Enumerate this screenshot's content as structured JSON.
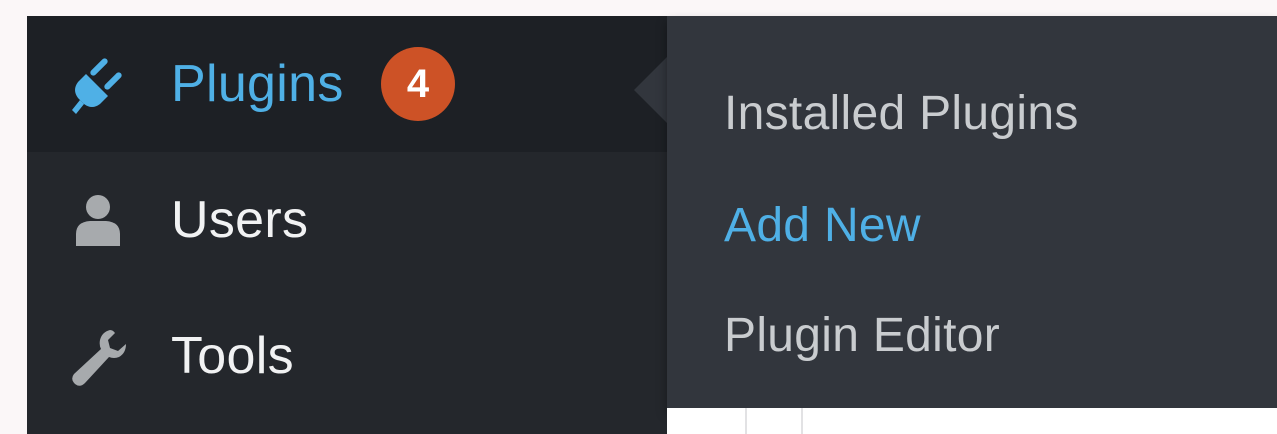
{
  "sidebar": {
    "items": [
      {
        "label": "Plugins",
        "icon": "plug-icon",
        "active": true,
        "badge": "4"
      },
      {
        "label": "Users",
        "icon": "user-icon",
        "active": false
      },
      {
        "label": "Tools",
        "icon": "wrench-icon",
        "active": false
      }
    ]
  },
  "flyout": {
    "items": [
      {
        "label": "Installed Plugins",
        "current": false
      },
      {
        "label": "Add New",
        "current": true
      },
      {
        "label": "Plugin Editor",
        "current": false
      }
    ]
  },
  "colors": {
    "sidebar_bg": "#24272c",
    "active_item_bg": "#1d2025",
    "flyout_bg": "#32363d",
    "accent": "#4fb0e6",
    "badge": "#cd5226",
    "icon_gray": "#a7aaad"
  }
}
